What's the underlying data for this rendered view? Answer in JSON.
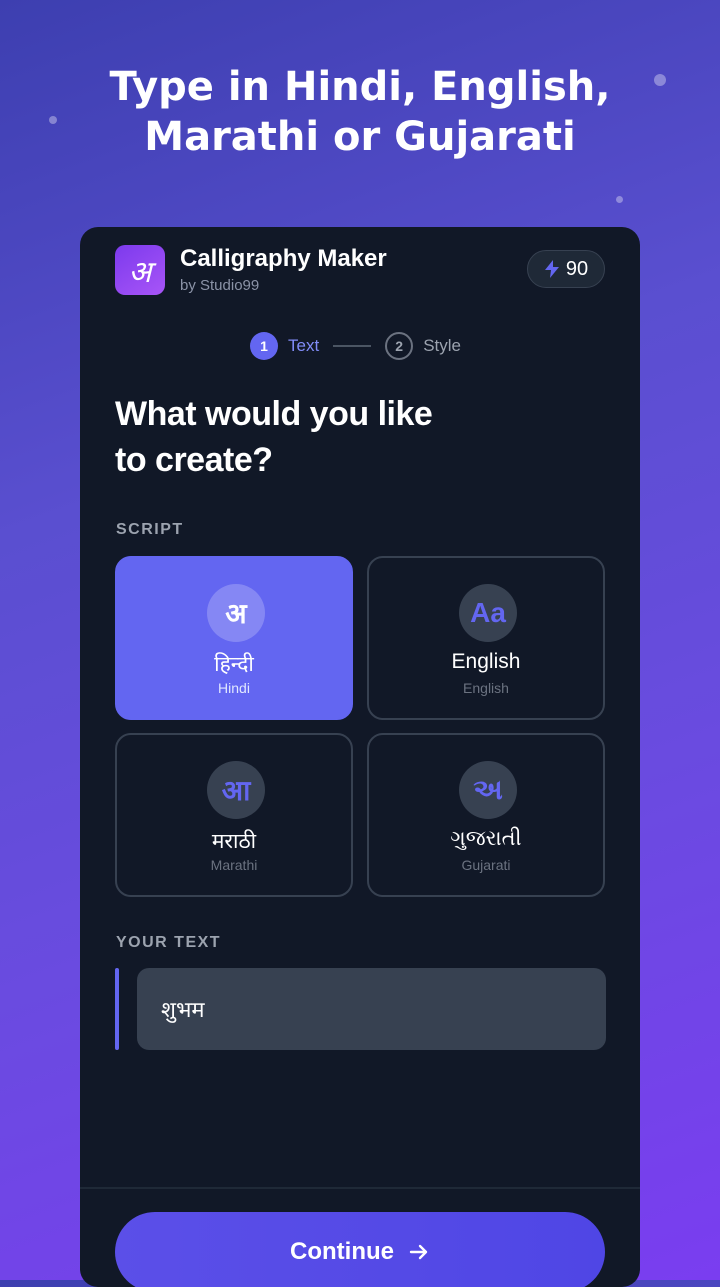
{
  "headline": {
    "line1": "Type in Hindi, English,",
    "line2": "Marathi or Gujarati"
  },
  "app": {
    "name": "Calligraphy Maker",
    "by": "by Studio99",
    "icon": "calligraphy-a-icon",
    "icon_glyph": "अ"
  },
  "credits": {
    "icon": "lightning-icon",
    "value": "90"
  },
  "stepper": {
    "steps": [
      {
        "num": "1",
        "label": "Text",
        "active": true
      },
      {
        "num": "2",
        "label": "Style",
        "active": false
      }
    ]
  },
  "question": {
    "line1": "What would you like",
    "line2": "to create?"
  },
  "script_section": {
    "label": "SCRIPT",
    "options": [
      {
        "glyph": "अ",
        "native": "हिन्दी",
        "latin": "Hindi",
        "selected": true
      },
      {
        "glyph": "Aa",
        "native": "English",
        "latin": "English",
        "selected": false
      },
      {
        "glyph": "आ",
        "native": "मराठी",
        "latin": "Marathi",
        "selected": false
      },
      {
        "glyph": "અ",
        "native": "ગુજરાતી",
        "latin": "Gujarati",
        "selected": false
      }
    ]
  },
  "text_section": {
    "label": "YOUR TEXT",
    "value": "शुभम"
  },
  "continue": {
    "label": "Continue",
    "icon": "arrow-right-icon"
  },
  "colors": {
    "accent": "#6366f1",
    "card_bg": "#111827",
    "input_bg": "#374151"
  }
}
